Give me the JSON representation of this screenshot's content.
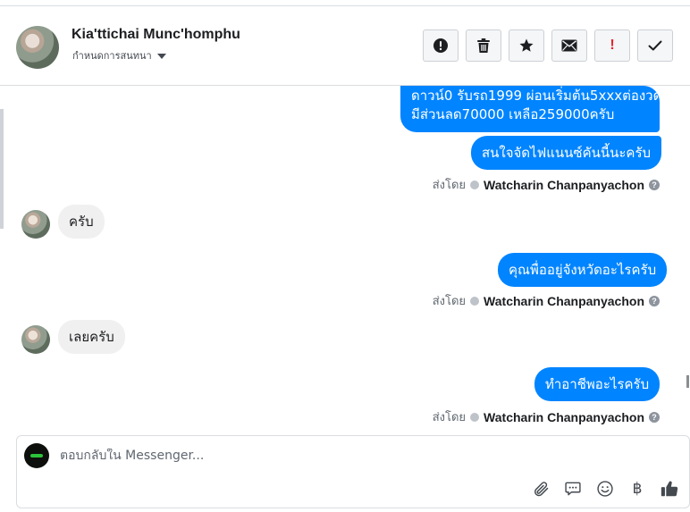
{
  "conversation": {
    "contact_name": "Kia'ttichai Munc'homphu",
    "assign_label": "กำหนดการสนทนา"
  },
  "toolbar": {
    "buttons": [
      {
        "name": "spam-report",
        "icon": "alert-circle-icon"
      },
      {
        "name": "delete",
        "icon": "trash-icon"
      },
      {
        "name": "star",
        "icon": "star-icon"
      },
      {
        "name": "mark-unread",
        "icon": "envelope-icon"
      },
      {
        "name": "mark-important",
        "icon": "exclamation-icon",
        "glyph": "!"
      },
      {
        "name": "mark-done",
        "icon": "checkmark-icon"
      }
    ]
  },
  "messages": {
    "out1_line1": "ดาวน์0 รับรถ1999 ผ่อนเริ่มต้น5xxxต่องวด",
    "out1_line2": "มีส่วนลด70000 เหลือ259000ครับ",
    "out2": "สนใจจัดไฟแนนซ์คันนี้นะครับ",
    "in1": "ครับ",
    "out3": "คุณพื่ออยู่จังหวัดอะไรครับ",
    "in2": "เลยครับ",
    "out4": "ทำอาชีพอะไรครับ"
  },
  "sent_by": {
    "prefix": "ส่งโดย",
    "name": "Watcharin Chanpanyachon",
    "help": "?"
  },
  "composer": {
    "placeholder": "ตอบกลับใน Messenger...",
    "baht_symbol": "฿"
  },
  "colors": {
    "outgoing_bubble": "#0084ff",
    "incoming_bubble": "#f1f0f0",
    "important_mark": "#e4252d"
  }
}
